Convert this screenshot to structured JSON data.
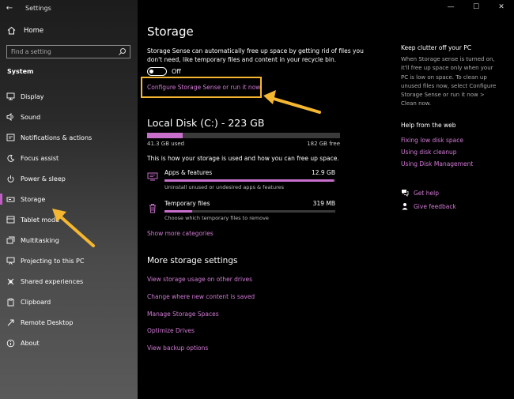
{
  "window": {
    "title": "Settings",
    "back_glyph": "←",
    "minimize_glyph": "—",
    "maximize_glyph": "☐",
    "close_glyph": "✕"
  },
  "sidebar": {
    "home_label": "Home",
    "search_placeholder": "Find a setting",
    "section": "System",
    "items": [
      {
        "label": "Display",
        "icon": "display-icon"
      },
      {
        "label": "Sound",
        "icon": "sound-icon"
      },
      {
        "label": "Notifications & actions",
        "icon": "notifications-icon"
      },
      {
        "label": "Focus assist",
        "icon": "focus-assist-icon"
      },
      {
        "label": "Power & sleep",
        "icon": "power-icon"
      },
      {
        "label": "Storage",
        "icon": "storage-icon",
        "selected": true
      },
      {
        "label": "Tablet mode",
        "icon": "tablet-mode-icon"
      },
      {
        "label": "Multitasking",
        "icon": "multitasking-icon"
      },
      {
        "label": "Projecting to this PC",
        "icon": "projecting-icon"
      },
      {
        "label": "Shared experiences",
        "icon": "shared-experiences-icon"
      },
      {
        "label": "Clipboard",
        "icon": "clipboard-icon"
      },
      {
        "label": "Remote Desktop",
        "icon": "remote-desktop-icon"
      },
      {
        "label": "About",
        "icon": "about-icon"
      }
    ]
  },
  "main": {
    "title": "Storage",
    "description": "Storage Sense can automatically free up space by getting rid of files you don't need, like temporary files and content in your recycle bin.",
    "toggle_label": "Off",
    "configure_link": "Configure Storage Sense or run it now",
    "disk": {
      "title": "Local Disk (C:) - 223 GB",
      "used": "41.3 GB used",
      "free": "182 GB free",
      "used_fraction": 0.185
    },
    "howto": "This is how your storage is used and how you can free up space.",
    "categories": [
      {
        "name": "Apps & features",
        "size": "12.9 GB",
        "desc": "Uninstall unused or undesired apps & features",
        "fraction": 0.99,
        "icon": "apps-features-icon"
      },
      {
        "name": "Temporary files",
        "size": "319 MB",
        "desc": "Choose which temporary files to remove",
        "fraction": 0.16,
        "icon": "trash-icon"
      }
    ],
    "show_more": "Show more categories",
    "more_title": "More storage settings",
    "more_links": [
      "View storage usage on other drives",
      "Change where new content is saved",
      "Manage Storage Spaces",
      "Optimize Drives",
      "View backup options"
    ]
  },
  "right": {
    "clutter_head": "Keep clutter off your PC",
    "clutter_text": "When Storage sense is turned on, it'll free up space only when your PC is low on space. To clean up unused files now, select Configure Storage Sense or run it now > Clean now.",
    "help_head": "Help from the web",
    "help_links": [
      "Fixing low disk space",
      "Using disk cleanup",
      "Using Disk Management"
    ],
    "get_help": "Get help",
    "give_feedback": "Give feedback"
  },
  "colors": {
    "accent": "#c86fcc",
    "link": "#d27ad6",
    "highlight": "#f5b731"
  }
}
